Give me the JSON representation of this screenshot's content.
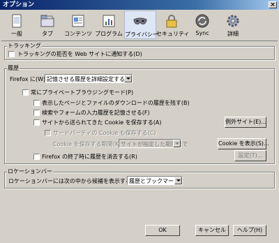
{
  "window": {
    "title": "オプション",
    "close_label": "×"
  },
  "toolbar": {
    "tabs": [
      {
        "label": "一般",
        "icon": "general-icon"
      },
      {
        "label": "タブ",
        "icon": "tabs-icon"
      },
      {
        "label": "コンテンツ",
        "icon": "content-icon"
      },
      {
        "label": "プログラム",
        "icon": "applications-icon"
      },
      {
        "label": "プライバシー",
        "icon": "privacy-mask-icon",
        "selected": true
      },
      {
        "label": "セキュリティ",
        "icon": "lock-icon"
      },
      {
        "label": "Sync",
        "icon": "sync-icon"
      },
      {
        "label": "詳細",
        "icon": "gear-icon"
      }
    ]
  },
  "tracking": {
    "title": "トラッキング",
    "do_not_track_label": "トラッキングの拒否を Web サイトに通知する(D)"
  },
  "history": {
    "title": "履歴",
    "firefox_label": "Firefox に(W)",
    "mode_value": "記憶させる履歴を詳細設定する",
    "private_label": "常にプライベートブラウジングモード(P)",
    "remember_browsing_label": "表示したページとファイルのダウンロードの履歴を残す(B)",
    "remember_search_label": "検索やフォームの入力履歴を記憶させる(F)",
    "accept_cookies_label": "サイトから送られてきた Cookie を保存する(A)",
    "exceptions_button": "例外サイト(E)...",
    "third_party_label": "サードパーティの Cookie も保存する(C)",
    "keep_until_label": "Cookie を保存する期間(K):",
    "keep_until_value": "サイトが指定した期限まで",
    "show_cookies_button": "Cookie を表示(S)...",
    "clear_on_close_label": "Firefox の終了時に履歴を消去する(R)",
    "settings_button": "設定(T)..."
  },
  "location_bar": {
    "title": "ロケーションバー",
    "suggest_label": "ロケーションバーには次の中から候補を表示する(L):",
    "suggest_value": "履歴とブックマーク"
  },
  "footer": {
    "ok_button": "OK",
    "cancel_button": "キャンセル",
    "help_button": "ヘルプ(H)"
  }
}
